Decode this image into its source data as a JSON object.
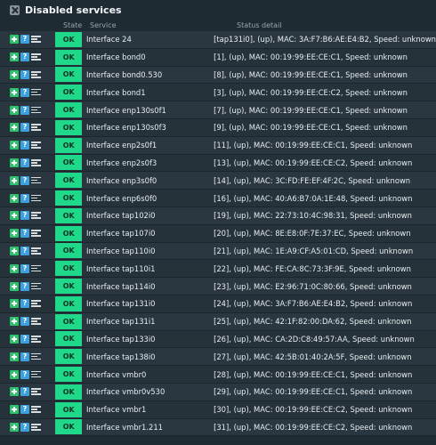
{
  "title": "Disabled services",
  "columns": {
    "state": "State",
    "service": "Service",
    "status": "Status detail"
  },
  "rows": [
    {
      "state": "OK",
      "service": "Interface 24",
      "detail": "[tap131i0], (up), MAC: 3A:F7:B6:AE:E4:B2, Speed: unknown"
    },
    {
      "state": "OK",
      "service": "Interface bond0",
      "detail": "[1], (up), MAC: 00:19:99:EE:CE:C1, Speed: unknown"
    },
    {
      "state": "OK",
      "service": "Interface bond0.530",
      "detail": "[8], (up), MAC: 00:19:99:EE:CE:C1, Speed: unknown"
    },
    {
      "state": "OK",
      "service": "Interface bond1",
      "detail": "[3], (up), MAC: 00:19:99:EE:CE:C2, Speed: unknown"
    },
    {
      "state": "OK",
      "service": "Interface enp130s0f1",
      "detail": "[7], (up), MAC: 00:19:99:EE:CE:C1, Speed: unknown"
    },
    {
      "state": "OK",
      "service": "Interface enp130s0f3",
      "detail": "[9], (up), MAC: 00:19:99:EE:CE:C1, Speed: unknown"
    },
    {
      "state": "OK",
      "service": "Interface enp2s0f1",
      "detail": "[11], (up), MAC: 00:19:99:EE:CE:C1, Speed: unknown"
    },
    {
      "state": "OK",
      "service": "Interface enp2s0f3",
      "detail": "[13], (up), MAC: 00:19:99:EE:CE:C2, Speed: unknown"
    },
    {
      "state": "OK",
      "service": "Interface enp3s0f0",
      "detail": "[14], (up), MAC: 3C:FD:FE:EF:4F:2C, Speed: unknown"
    },
    {
      "state": "OK",
      "service": "Interface enp6s0f0",
      "detail": "[16], (up), MAC: 40:A6:B7:0A:1E:48, Speed: unknown"
    },
    {
      "state": "OK",
      "service": "Interface tap102i0",
      "detail": "[19], (up), MAC: 22:73:10:4C:98:31, Speed: unknown"
    },
    {
      "state": "OK",
      "service": "Interface tap107i0",
      "detail": "[20], (up), MAC: 8E:E8:0F:7E:37:EC, Speed: unknown"
    },
    {
      "state": "OK",
      "service": "Interface tap110i0",
      "detail": "[21], (up), MAC: 1E:A9:CF:A5:01:CD, Speed: unknown"
    },
    {
      "state": "OK",
      "service": "Interface tap110i1",
      "detail": "[22], (up), MAC: FE:CA:8C:73:3F:9E, Speed: unknown"
    },
    {
      "state": "OK",
      "service": "Interface tap114i0",
      "detail": "[23], (up), MAC: E2:96:71:0C:80:66, Speed: unknown"
    },
    {
      "state": "OK",
      "service": "Interface tap131i0",
      "detail": "[24], (up), MAC: 3A:F7:B6:AE:E4:B2, Speed: unknown"
    },
    {
      "state": "OK",
      "service": "Interface tap131i1",
      "detail": "[25], (up), MAC: 42:1F:82:00:DA:62, Speed: unknown"
    },
    {
      "state": "OK",
      "service": "Interface tap133i0",
      "detail": "[26], (up), MAC: CA:2D:C8:49:57:AA, Speed: unknown"
    },
    {
      "state": "OK",
      "service": "Interface tap138i0",
      "detail": "[27], (up), MAC: 42:5B:01:40:2A:5F, Speed: unknown"
    },
    {
      "state": "OK",
      "service": "Interface vmbr0",
      "detail": "[28], (up), MAC: 00:19:99:EE:CE:C1, Speed: unknown"
    },
    {
      "state": "OK",
      "service": "Interface vmbr0v530",
      "detail": "[29], (up), MAC: 00:19:99:EE:CE:C1, Speed: unknown"
    },
    {
      "state": "OK",
      "service": "Interface vmbr1",
      "detail": "[30], (up), MAC: 00:19:99:EE:CE:C2, Speed: unknown"
    },
    {
      "state": "OK",
      "service": "Interface vmbr1.211",
      "detail": "[31], (up), MAC: 00:19:99:EE:CE:C2, Speed: unknown"
    }
  ]
}
